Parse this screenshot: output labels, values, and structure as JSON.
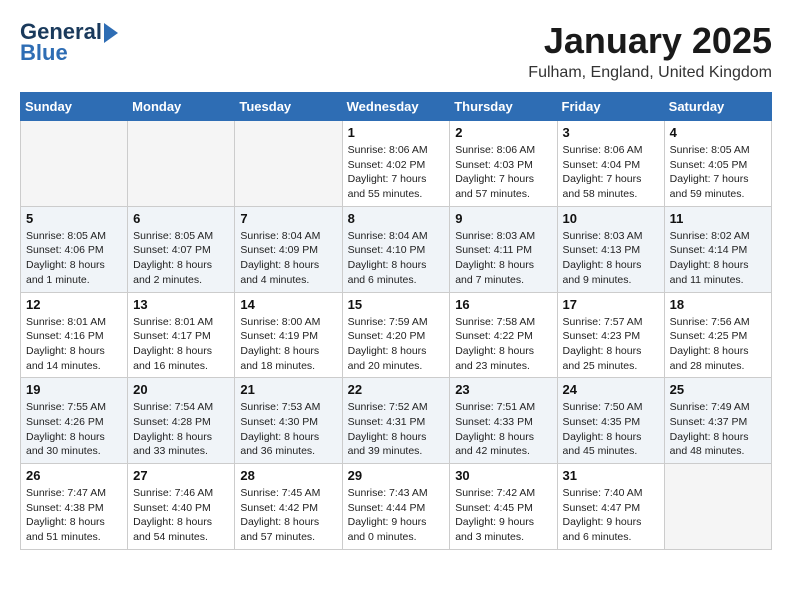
{
  "header": {
    "logo_line1": "General",
    "logo_line2": "Blue",
    "title": "January 2025",
    "subtitle": "Fulham, England, United Kingdom"
  },
  "days_of_week": [
    "Sunday",
    "Monday",
    "Tuesday",
    "Wednesday",
    "Thursday",
    "Friday",
    "Saturday"
  ],
  "weeks": [
    {
      "shaded": false,
      "days": [
        {
          "date": "",
          "info": ""
        },
        {
          "date": "",
          "info": ""
        },
        {
          "date": "",
          "info": ""
        },
        {
          "date": "1",
          "info": "Sunrise: 8:06 AM\nSunset: 4:02 PM\nDaylight: 7 hours\nand 55 minutes."
        },
        {
          "date": "2",
          "info": "Sunrise: 8:06 AM\nSunset: 4:03 PM\nDaylight: 7 hours\nand 57 minutes."
        },
        {
          "date": "3",
          "info": "Sunrise: 8:06 AM\nSunset: 4:04 PM\nDaylight: 7 hours\nand 58 minutes."
        },
        {
          "date": "4",
          "info": "Sunrise: 8:05 AM\nSunset: 4:05 PM\nDaylight: 7 hours\nand 59 minutes."
        }
      ]
    },
    {
      "shaded": true,
      "days": [
        {
          "date": "5",
          "info": "Sunrise: 8:05 AM\nSunset: 4:06 PM\nDaylight: 8 hours\nand 1 minute."
        },
        {
          "date": "6",
          "info": "Sunrise: 8:05 AM\nSunset: 4:07 PM\nDaylight: 8 hours\nand 2 minutes."
        },
        {
          "date": "7",
          "info": "Sunrise: 8:04 AM\nSunset: 4:09 PM\nDaylight: 8 hours\nand 4 minutes."
        },
        {
          "date": "8",
          "info": "Sunrise: 8:04 AM\nSunset: 4:10 PM\nDaylight: 8 hours\nand 6 minutes."
        },
        {
          "date": "9",
          "info": "Sunrise: 8:03 AM\nSunset: 4:11 PM\nDaylight: 8 hours\nand 7 minutes."
        },
        {
          "date": "10",
          "info": "Sunrise: 8:03 AM\nSunset: 4:13 PM\nDaylight: 8 hours\nand 9 minutes."
        },
        {
          "date": "11",
          "info": "Sunrise: 8:02 AM\nSunset: 4:14 PM\nDaylight: 8 hours\nand 11 minutes."
        }
      ]
    },
    {
      "shaded": false,
      "days": [
        {
          "date": "12",
          "info": "Sunrise: 8:01 AM\nSunset: 4:16 PM\nDaylight: 8 hours\nand 14 minutes."
        },
        {
          "date": "13",
          "info": "Sunrise: 8:01 AM\nSunset: 4:17 PM\nDaylight: 8 hours\nand 16 minutes."
        },
        {
          "date": "14",
          "info": "Sunrise: 8:00 AM\nSunset: 4:19 PM\nDaylight: 8 hours\nand 18 minutes."
        },
        {
          "date": "15",
          "info": "Sunrise: 7:59 AM\nSunset: 4:20 PM\nDaylight: 8 hours\nand 20 minutes."
        },
        {
          "date": "16",
          "info": "Sunrise: 7:58 AM\nSunset: 4:22 PM\nDaylight: 8 hours\nand 23 minutes."
        },
        {
          "date": "17",
          "info": "Sunrise: 7:57 AM\nSunset: 4:23 PM\nDaylight: 8 hours\nand 25 minutes."
        },
        {
          "date": "18",
          "info": "Sunrise: 7:56 AM\nSunset: 4:25 PM\nDaylight: 8 hours\nand 28 minutes."
        }
      ]
    },
    {
      "shaded": true,
      "days": [
        {
          "date": "19",
          "info": "Sunrise: 7:55 AM\nSunset: 4:26 PM\nDaylight: 8 hours\nand 30 minutes."
        },
        {
          "date": "20",
          "info": "Sunrise: 7:54 AM\nSunset: 4:28 PM\nDaylight: 8 hours\nand 33 minutes."
        },
        {
          "date": "21",
          "info": "Sunrise: 7:53 AM\nSunset: 4:30 PM\nDaylight: 8 hours\nand 36 minutes."
        },
        {
          "date": "22",
          "info": "Sunrise: 7:52 AM\nSunset: 4:31 PM\nDaylight: 8 hours\nand 39 minutes."
        },
        {
          "date": "23",
          "info": "Sunrise: 7:51 AM\nSunset: 4:33 PM\nDaylight: 8 hours\nand 42 minutes."
        },
        {
          "date": "24",
          "info": "Sunrise: 7:50 AM\nSunset: 4:35 PM\nDaylight: 8 hours\nand 45 minutes."
        },
        {
          "date": "25",
          "info": "Sunrise: 7:49 AM\nSunset: 4:37 PM\nDaylight: 8 hours\nand 48 minutes."
        }
      ]
    },
    {
      "shaded": false,
      "days": [
        {
          "date": "26",
          "info": "Sunrise: 7:47 AM\nSunset: 4:38 PM\nDaylight: 8 hours\nand 51 minutes."
        },
        {
          "date": "27",
          "info": "Sunrise: 7:46 AM\nSunset: 4:40 PM\nDaylight: 8 hours\nand 54 minutes."
        },
        {
          "date": "28",
          "info": "Sunrise: 7:45 AM\nSunset: 4:42 PM\nDaylight: 8 hours\nand 57 minutes."
        },
        {
          "date": "29",
          "info": "Sunrise: 7:43 AM\nSunset: 4:44 PM\nDaylight: 9 hours\nand 0 minutes."
        },
        {
          "date": "30",
          "info": "Sunrise: 7:42 AM\nSunset: 4:45 PM\nDaylight: 9 hours\nand 3 minutes."
        },
        {
          "date": "31",
          "info": "Sunrise: 7:40 AM\nSunset: 4:47 PM\nDaylight: 9 hours\nand 6 minutes."
        },
        {
          "date": "",
          "info": ""
        }
      ]
    }
  ]
}
